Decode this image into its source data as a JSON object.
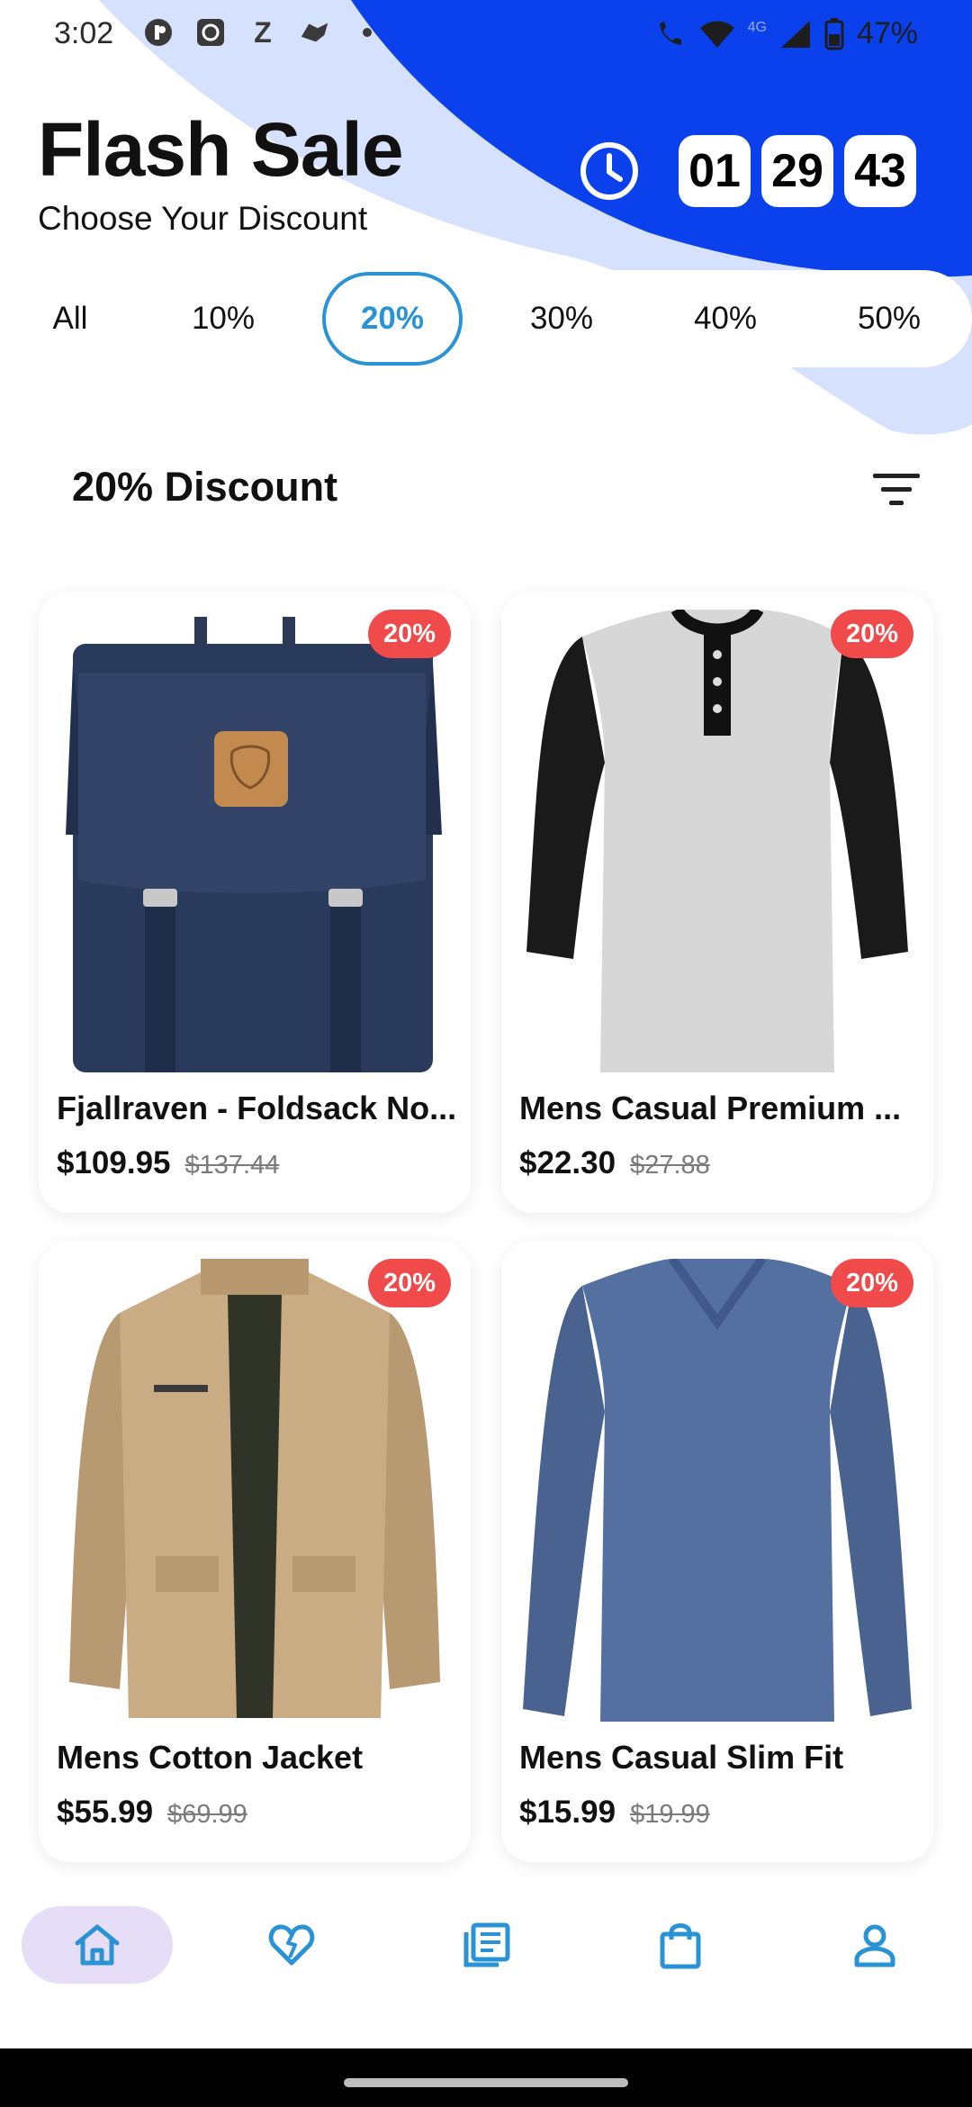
{
  "status_bar": {
    "time": "3:02",
    "left_icons": [
      "app-icon",
      "camera-icon",
      "z-icon",
      "handshake-icon",
      "dot-icon"
    ],
    "network_label": "4G",
    "battery": "47%"
  },
  "header": {
    "title": "Flash Sale",
    "subtitle": "Choose Your Discount",
    "timer": {
      "hours": "01",
      "minutes": "29",
      "seconds": "43"
    }
  },
  "tabs": [
    {
      "label": "All",
      "active": false
    },
    {
      "label": "10%",
      "active": false
    },
    {
      "label": "20%",
      "active": true
    },
    {
      "label": "30%",
      "active": false
    },
    {
      "label": "40%",
      "active": false
    },
    {
      "label": "50%",
      "active": false
    }
  ],
  "section": {
    "title": "20% Discount"
  },
  "products": [
    {
      "name": "Fjallraven - Foldsack No...",
      "price": "$109.95",
      "old_price": "$137.44",
      "badge": "20%",
      "image": "backpack"
    },
    {
      "name": "Mens Casual Premium ...",
      "price": "$22.30",
      "old_price": "$27.88",
      "badge": "20%",
      "image": "raglan-tshirt"
    },
    {
      "name": "Mens Cotton Jacket",
      "price": "$55.99",
      "old_price": "$69.99",
      "badge": "20%",
      "image": "jacket"
    },
    {
      "name": "Mens Casual Slim Fit",
      "price": "$15.99",
      "old_price": "$19.99",
      "badge": "20%",
      "image": "long-sleeve-shirt"
    }
  ],
  "bottom_nav": [
    {
      "icon": "home-icon",
      "active": true
    },
    {
      "icon": "broken-heart-icon",
      "active": false
    },
    {
      "icon": "list-icon",
      "active": false
    },
    {
      "icon": "shopping-bag-icon",
      "active": false
    },
    {
      "icon": "profile-icon",
      "active": false
    }
  ],
  "colors": {
    "accent": "#2a93d5",
    "blob_dark": "#0a41ec",
    "blob_light": "#d5e1fd",
    "badge": "#f04a4a",
    "nav_active_bg": "#e6ddf7"
  }
}
